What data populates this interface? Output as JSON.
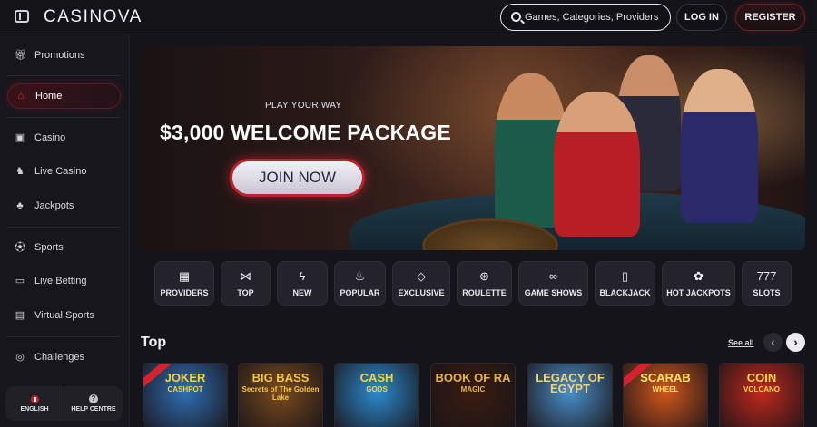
{
  "header": {
    "logo": "CASINOVA",
    "search_placeholder": "Games, Categories, Providers",
    "login_label": "LOG IN",
    "register_label": "REGISTER"
  },
  "sidebar": {
    "items": [
      {
        "label": "Promotions",
        "icon": "gift-icon"
      },
      {
        "label": "Home",
        "icon": "home-icon",
        "active": true
      },
      {
        "label": "Casino",
        "icon": "slot-machine-icon"
      },
      {
        "label": "Live Casino",
        "icon": "live-casino-icon"
      },
      {
        "label": "Jackpots",
        "icon": "clover-icon"
      },
      {
        "label": "Sports",
        "icon": "soccer-ball-icon"
      },
      {
        "label": "Live Betting",
        "icon": "live-icon"
      },
      {
        "label": "Virtual Sports",
        "icon": "virtual-sports-icon"
      },
      {
        "label": "Challenges",
        "icon": "challenge-icon"
      }
    ],
    "language_label": "ENGLISH",
    "help_label": "HELP CENTRE"
  },
  "banner": {
    "tagline": "PLAY YOUR WAY",
    "headline": "$3,000 WELCOME PACKAGE",
    "cta_label": "JOIN NOW"
  },
  "categories": [
    {
      "label": "PROVIDERS",
      "icon": "cards-icon"
    },
    {
      "label": "TOP",
      "icon": "bow-tie-icon"
    },
    {
      "label": "NEW",
      "icon": "lightning-icon"
    },
    {
      "label": "POPULAR",
      "icon": "flame-icon"
    },
    {
      "label": "EXCLUSIVE",
      "icon": "diamond-icon"
    },
    {
      "label": "ROULETTE",
      "icon": "roulette-icon"
    },
    {
      "label": "GAME SHOWS",
      "icon": "mask-icon"
    },
    {
      "label": "BLACKJACK",
      "icon": "playing-cards-icon"
    },
    {
      "label": "HOT JACKPOTS",
      "icon": "money-bag-icon"
    },
    {
      "label": "SLOTS",
      "icon": "sevens-icon"
    }
  ],
  "section": {
    "title": "Top",
    "see_all_label": "See all"
  },
  "games": [
    {
      "title": "JOKER",
      "subtitle": "CASHPOT",
      "bg": "#2f6fb5",
      "color": "#f7d23b"
    },
    {
      "title": "BIG BASS",
      "subtitle": "Secrets of The Golden Lake",
      "bg": "#7a4a20",
      "color": "#f5c542"
    },
    {
      "title": "CASH",
      "subtitle": "GODS",
      "bg": "#2b8bd0",
      "color": "#f6d14a"
    },
    {
      "title": "BOOK OF RA",
      "subtitle": "MAGIC",
      "bg": "#3a1c10",
      "color": "#e8b44a"
    },
    {
      "title": "LEGACY OF EGYPT",
      "subtitle": "",
      "bg": "#4a8fc9",
      "color": "#f2d27a"
    },
    {
      "title": "SCARAB",
      "subtitle": "WHEEL",
      "bg": "#d2571c",
      "color": "#ffe16a"
    },
    {
      "title": "COIN",
      "subtitle": "VOLCANO",
      "bg": "#c2281e",
      "color": "#ffd84a"
    }
  ],
  "colors": {
    "accent": "#e0283c",
    "background": "#15141a"
  }
}
